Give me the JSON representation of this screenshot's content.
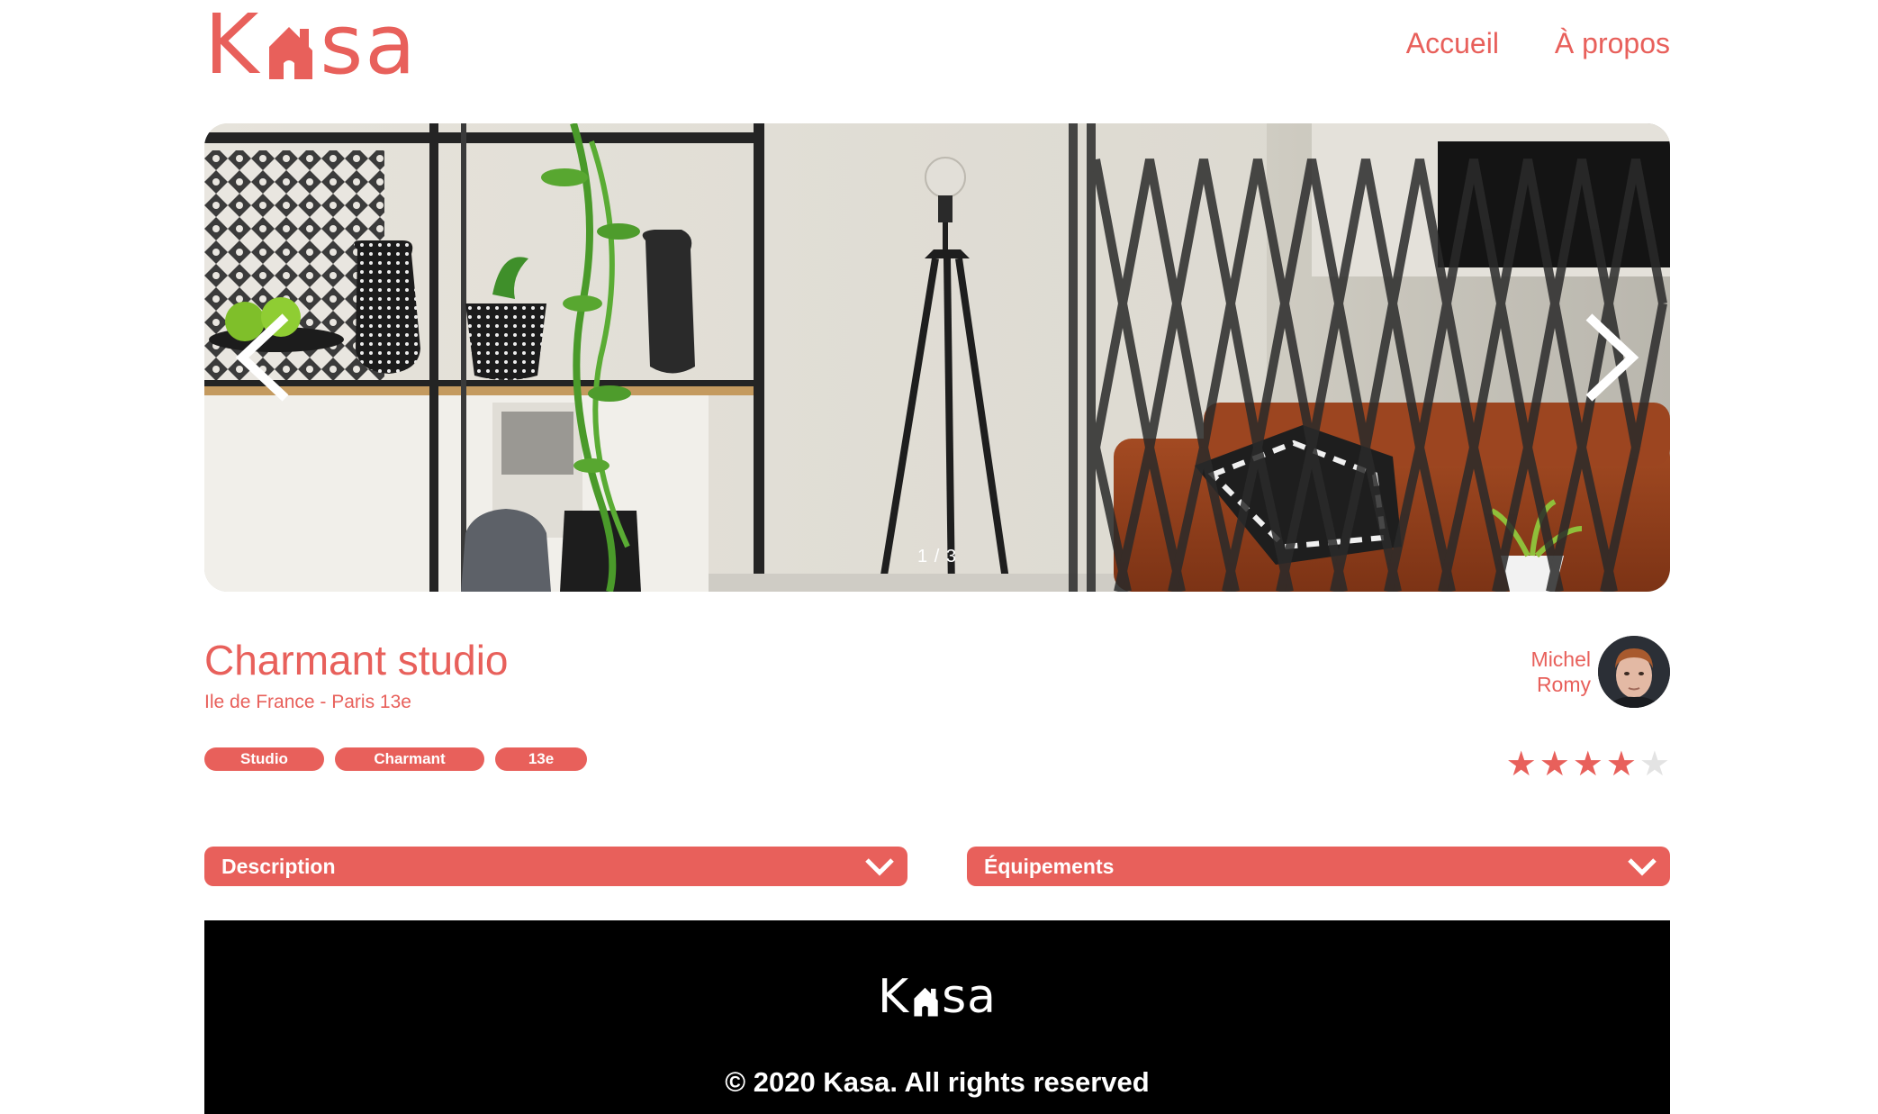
{
  "brand": {
    "logo_text": "Kasa",
    "accent_color": "#E8605B"
  },
  "nav": {
    "home": "Accueil",
    "about": "À propos"
  },
  "carousel": {
    "counter": "1 / 3",
    "prev_icon": "chevron-left-icon",
    "next_icon": "chevron-right-icon"
  },
  "listing": {
    "title": "Charmant studio",
    "location": "Ile de France - Paris 13e",
    "tags": [
      "Studio",
      "Charmant",
      "13e"
    ],
    "host": {
      "first_name": "Michel",
      "last_name": "Romy"
    },
    "rating": 4,
    "rating_max": 5
  },
  "collapses": {
    "description": "Description",
    "equipments": "Équipements"
  },
  "footer": {
    "logo_text": "Kasa",
    "copyright": "© 2020 Kasa. All rights reserved"
  }
}
